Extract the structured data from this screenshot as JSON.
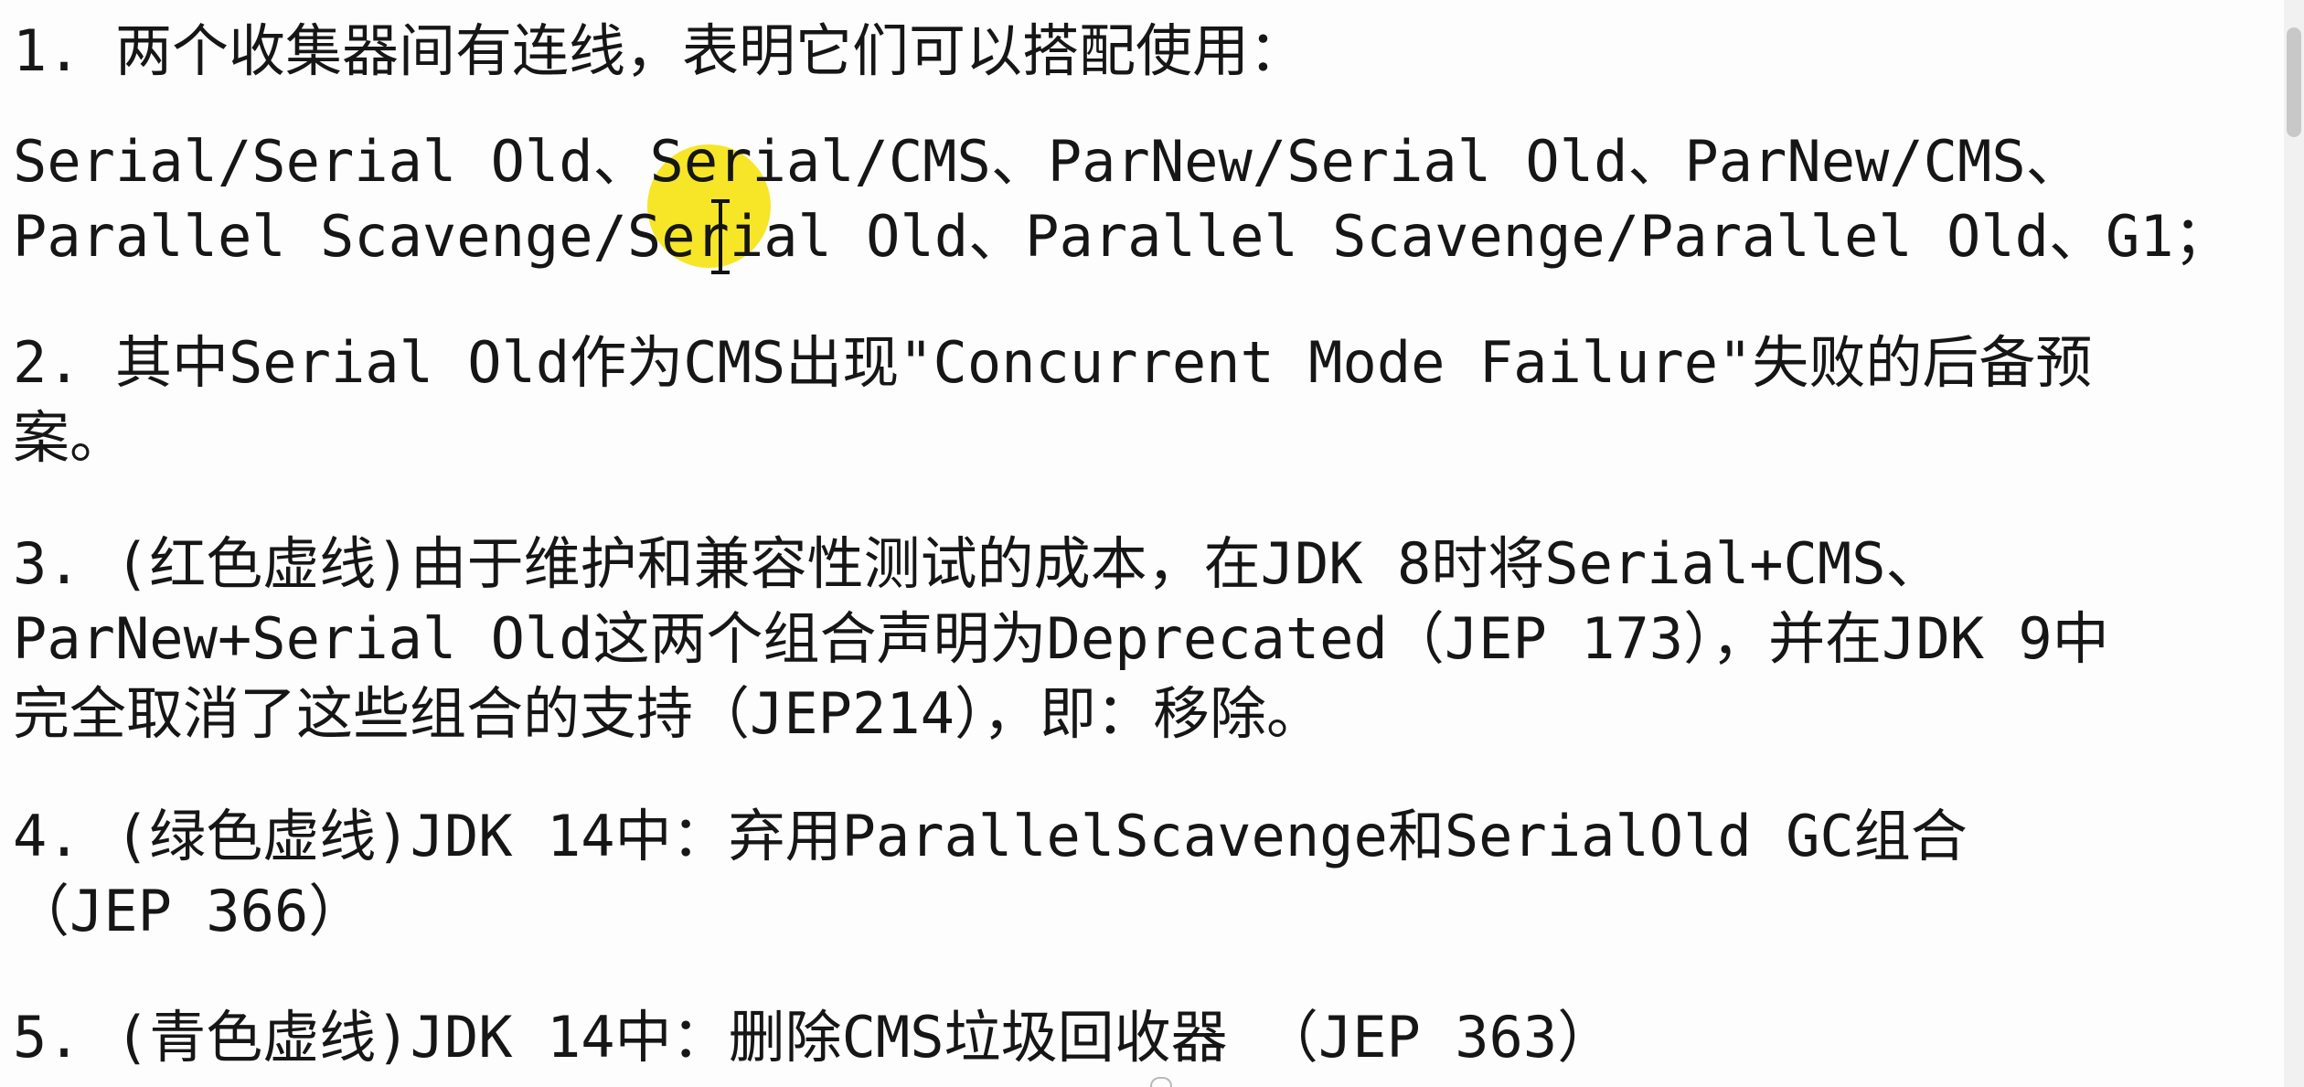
{
  "document": {
    "lines": [
      "1. 两个收集器间有连线，表明它们可以搭配使用：",
      "Serial/Serial Old、Serial/CMS、ParNew/Serial Old、ParNew/CMS、",
      "Parallel Scavenge/Serial Old、Parallel Scavenge/Parallel Old、G1；",
      "2. 其中Serial Old作为CMS出现\"Concurrent Mode Failure\"失败的后备预",
      "案。",
      "3. (红色虚线)由于维护和兼容性测试的成本，在JDK 8时将Serial+CMS、",
      "ParNew+Serial Old这两个组合声明为Deprecated（JEP 173），并在JDK 9中",
      "完全取消了这些组合的支持（JEP214），即：移除。",
      "4. (绿色虚线)JDK 14中：弃用ParallelScavenge和SerialOld GC组合",
      "（JEP 366）",
      "5. (青色虚线)JDK 14中：删除CMS垃圾回收器 （JEP 363）"
    ]
  }
}
